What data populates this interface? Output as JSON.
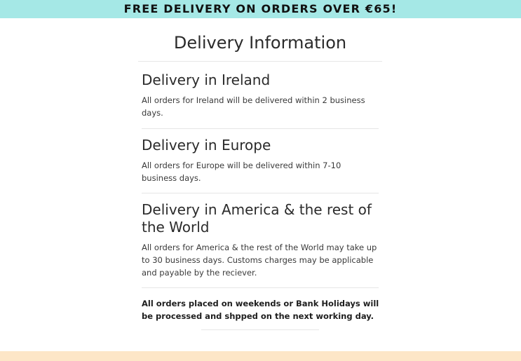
{
  "banner": {
    "text": "FREE DELIVERY ON ORDERS OVER €65!"
  },
  "page": {
    "title": "Delivery Information"
  },
  "sections": [
    {
      "heading": "Delivery in Ireland",
      "body": "All orders for Ireland will be delivered within 2 business days."
    },
    {
      "heading": "Delivery in Europe",
      "body": "All orders for Europe will be delivered within 7-10 business days."
    },
    {
      "heading": "Delivery in America & the rest of the World",
      "body": "All orders for America & the rest of the World may take up to 30 business days. Customs charges may be applicable and payable by the reciever."
    }
  ],
  "notice": {
    "text": "All orders placed on weekends or Bank Holidays will be processed and shpped on the next working day."
  },
  "colors": {
    "banner_bg": "#a5e8e6",
    "footer_bg": "#fde6c7",
    "text": "#2b2b2b"
  }
}
